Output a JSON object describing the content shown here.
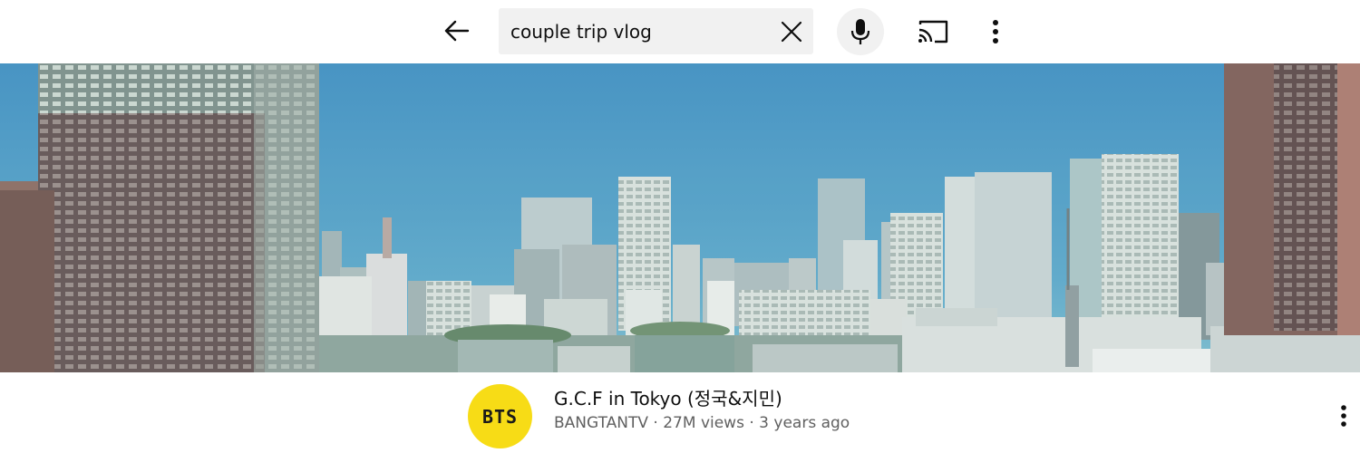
{
  "search": {
    "query": "couple trip vlog",
    "back_icon": "arrow-left-icon",
    "clear_icon": "close-icon",
    "mic_icon": "microphone-icon",
    "cast_icon": "cast-icon",
    "more_icon": "more-vert-icon"
  },
  "video": {
    "thumbnail_description_icon": "video-thumbnail",
    "title": "G.C.F in Tokyo (정국&지민)",
    "channel": "BANGTANTV",
    "separator": "·",
    "views": "27M views",
    "age": "3 years ago",
    "avatar_text": "BTS",
    "more_icon": "more-vert-icon"
  },
  "colors": {
    "avatar_bg": "#f7dc16",
    "search_bg": "#f1f1f1",
    "title_text": "#0f0f0f",
    "sub_text": "#606060"
  }
}
